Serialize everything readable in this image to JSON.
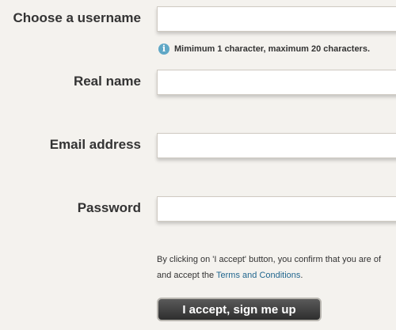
{
  "form": {
    "username": {
      "label": "Choose a username",
      "value": "",
      "hint": "Mimimum 1 character, maximum 20 characters."
    },
    "real_name": {
      "label": "Real name",
      "value": ""
    },
    "email": {
      "label": "Email address",
      "value": ""
    },
    "password": {
      "label": "Password",
      "value": ""
    },
    "terms": {
      "line1": "By clicking on 'I accept' button, you confirm that you are of",
      "line2_prefix": "and accept the ",
      "link_text": "Terms and Conditions",
      "line2_suffix": "."
    },
    "submit_label": "I accept, sign me up"
  },
  "icons": {
    "hint_icon": "info-icon",
    "hint_glyph": "i"
  },
  "colors": {
    "background": "#f4f2ee",
    "link": "#22678f",
    "info_icon": "#5fa7c6",
    "button": "#3a3a3a"
  }
}
